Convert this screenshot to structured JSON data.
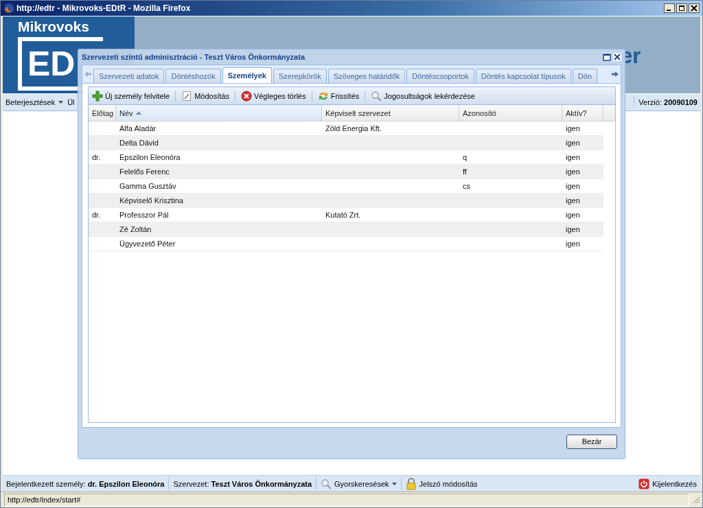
{
  "browser": {
    "title": "http://edtr - Mikrovoks-EDtR - Mozilla Firefox",
    "status_url": "http://edtr/index/start#"
  },
  "app": {
    "brand": "Mikrovoks",
    "logo_text": "ED",
    "banner_text": "er",
    "menu": [
      {
        "label": "Beterjesztések",
        "dropdown": true
      },
      {
        "label": "Ül",
        "dropdown": false
      }
    ],
    "version_label": "Verzió:",
    "version": "20090109"
  },
  "dialog": {
    "title": "Szervezeti szintű adminisztráció - Teszt Város Önkormányzata",
    "tabs": [
      {
        "label": "Szervezeti adatok",
        "selected": false
      },
      {
        "label": "Döntéshozók",
        "selected": false
      },
      {
        "label": "Személyek",
        "selected": true
      },
      {
        "label": "Szerepkörök",
        "selected": false
      },
      {
        "label": "Szöveges határidők",
        "selected": false
      },
      {
        "label": "Döntéscsoportok",
        "selected": false
      },
      {
        "label": "Döntés kapcsolat típusok",
        "selected": false
      },
      {
        "label": "Dön",
        "selected": false
      }
    ],
    "toolbar": [
      {
        "kind": "add",
        "label": "Új személy felvitele"
      },
      {
        "kind": "edit",
        "label": "Módosítás"
      },
      {
        "kind": "delete",
        "label": "Végleges törlés"
      },
      {
        "kind": "refresh",
        "label": "Frissítés"
      },
      {
        "kind": "search",
        "label": "Jogosultságok lekérdezése"
      }
    ],
    "table": {
      "columns": [
        {
          "label": "Előtag",
          "sorted_ascending": false
        },
        {
          "label": "Név",
          "sorted_ascending": true
        },
        {
          "label": "Képviselt szervezet",
          "sorted_ascending": false
        },
        {
          "label": "Azonosító",
          "sorted_ascending": false
        },
        {
          "label": "Aktív?",
          "sorted_ascending": false
        }
      ],
      "rows": [
        [
          "",
          "Alfa Aladár",
          "Zöld Energia Kft.",
          "",
          "igen"
        ],
        [
          "",
          "Delta Dávid",
          "",
          "",
          "igen"
        ],
        [
          "dr.",
          "Epszilon Eleonóra",
          "",
          "q",
          "igen"
        ],
        [
          "",
          "Felelős Ferenc",
          "",
          "ff",
          "igen"
        ],
        [
          "",
          "Gamma Gusztáv",
          "",
          "cs",
          "igen"
        ],
        [
          "",
          "Képviselő Krisztina",
          "",
          "",
          "igen"
        ],
        [
          "dr.",
          "Professzor Pál",
          "Kutató Zrt.",
          "",
          "igen"
        ],
        [
          "",
          "Zé Zoltán",
          "",
          "",
          "igen"
        ],
        [
          "",
          "Ügyvezető Péter",
          "",
          "",
          "igen"
        ]
      ]
    },
    "close_button": "Bezár"
  },
  "status_bar": {
    "user_label": "Bejelentkezett személy:",
    "user": "dr. Epszilon Eleonóra",
    "org_label": "Szervezet:",
    "org": "Teszt Város Önkormányzata",
    "quick_search": "Gyorskeresések",
    "password": "Jelszó módosítás",
    "logout": "Kijelentkezés"
  }
}
